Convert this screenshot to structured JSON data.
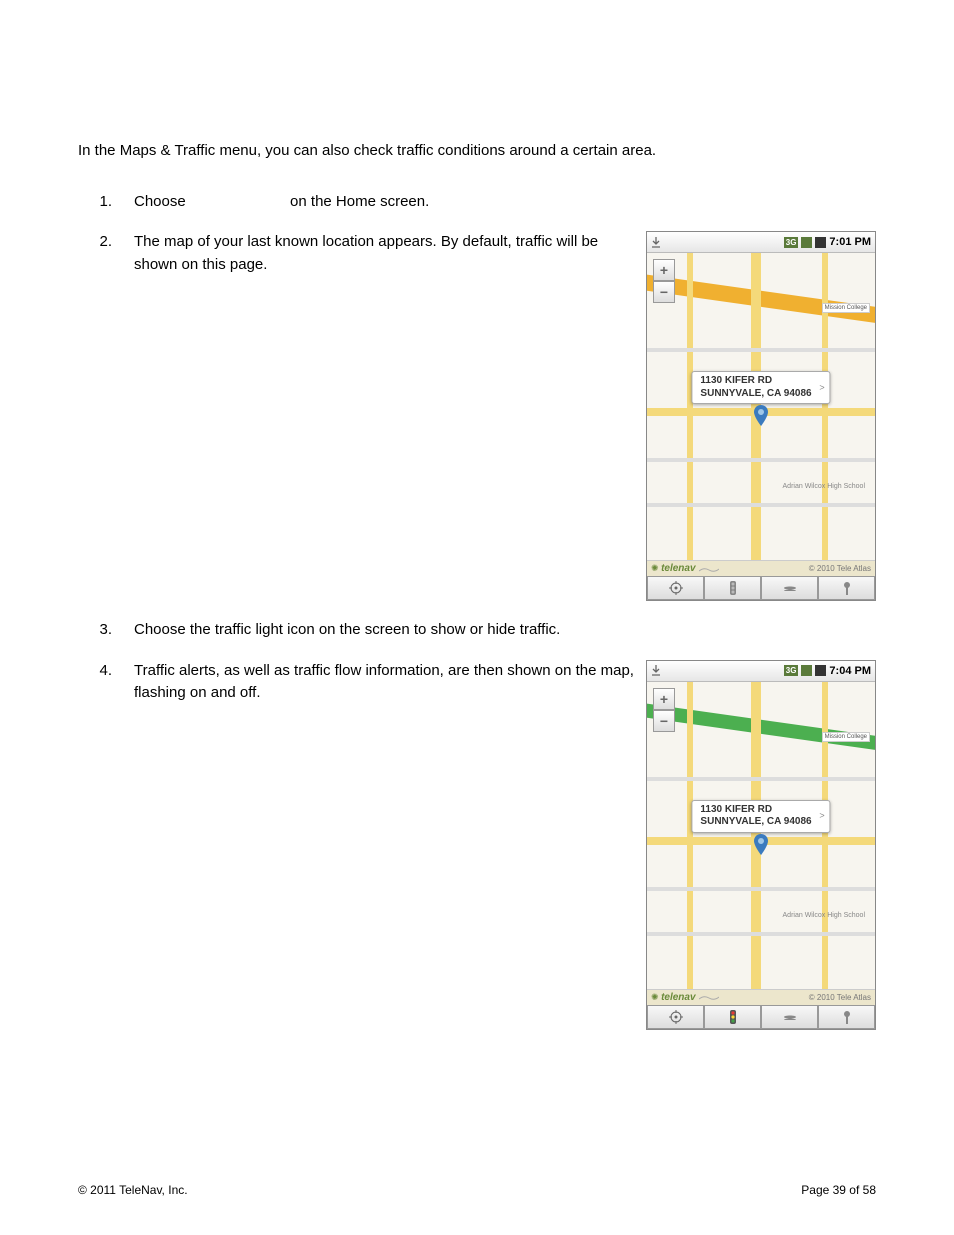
{
  "intro": "In the Maps & Traffic menu, you can also check traffic conditions around a certain area.",
  "steps": [
    {
      "n": "1.",
      "a": "Choose",
      "b": "on the Home screen."
    },
    {
      "n": "2.",
      "text": "The map of your last known location appears. By default, traffic will be shown on this page."
    },
    {
      "n": "3.",
      "text": "Choose the traffic light icon on the screen to show or hide traffic."
    },
    {
      "n": "4.",
      "text": "Traffic alerts, as well as traffic flow information, are then shown on the map, flashing on and off."
    }
  ],
  "screenshot": {
    "time1": "7:01 PM",
    "time2": "7:04 PM",
    "addr_line1": "1130 KIFER RD",
    "addr_line2": "SUNNYVALE, CA 94086",
    "brand": "telenav",
    "copyright": "© 2010 Tele Atlas",
    "college": "Mission College",
    "school": "Adrian Wilcox High School"
  },
  "footer": {
    "left": "© 2011 TeleNav, Inc.",
    "right": "Page 39 of 58"
  }
}
